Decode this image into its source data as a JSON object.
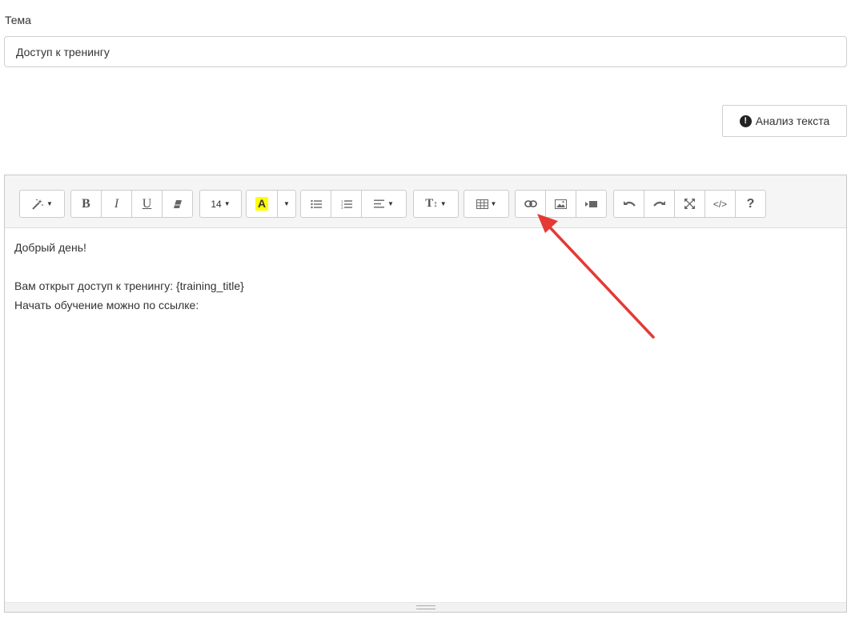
{
  "subject": {
    "label": "Тема",
    "value": "Доступ к тренингу"
  },
  "analyze_button": {
    "label": "Анализ текста",
    "icon": "exclamation-circle-icon"
  },
  "toolbar": {
    "style_icon": "magic-wand-icon",
    "bold": "B",
    "italic": "I",
    "underline": "U",
    "eraser_icon": "eraser-icon",
    "font_size": "14",
    "highlight_letter": "A",
    "highlight_color": "#ffff00",
    "unordered_list_icon": "unordered-list-icon",
    "ordered_list_icon": "ordered-list-icon",
    "align_icon": "align-left-icon",
    "line_height_icon": "text-height-icon",
    "table_icon": "table-icon",
    "link_icon": "link-icon",
    "image_icon": "image-icon",
    "video_icon": "video-icon",
    "undo_icon": "undo-icon",
    "redo_icon": "redo-icon",
    "fullscreen_icon": "fullscreen-icon",
    "code_label": "</>",
    "help_label": "?"
  },
  "body": {
    "lines": [
      "Добрый день!",
      "",
      "Вам открыт доступ к тренингу: {training_title}",
      "Начать обучение можно по ссылке:"
    ]
  },
  "annotation": {
    "arrow_color": "#e53935"
  }
}
